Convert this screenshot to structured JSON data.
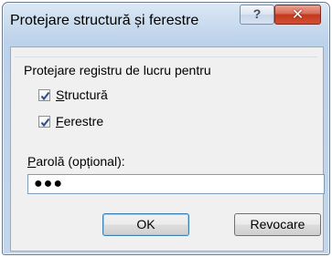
{
  "window": {
    "title": "Protejare structură și ferestre",
    "help_glyph": "?",
    "close_glyph": "✕"
  },
  "group": {
    "label": "Protejare registru de lucru pentru"
  },
  "options": [
    {
      "label_mnemonic": "S",
      "label_rest": "tructură",
      "checked": true
    },
    {
      "label_mnemonic": "F",
      "label_rest": "erestre",
      "checked": true
    }
  ],
  "password": {
    "label_mnemonic": "P",
    "label_rest": "arolă (opțional):",
    "value": "●●●"
  },
  "buttons": {
    "ok": "OK",
    "cancel": "Revocare"
  },
  "colors": {
    "checkmark": "#2c4e8a",
    "default_button_border": "#3c7fb1"
  }
}
